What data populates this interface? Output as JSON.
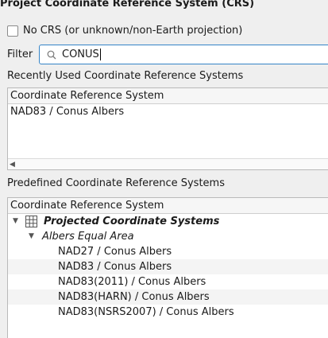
{
  "dialog": {
    "title": "Project Coordinate Reference System (CRS)"
  },
  "no_crs": {
    "label": "No CRS (or unknown/non-Earth projection)",
    "checked": false
  },
  "filter": {
    "label": "Filter",
    "value": "CONUS",
    "icon": "search-icon"
  },
  "recent": {
    "label": "Recently Used Coordinate Reference Systems",
    "column_header": "Coordinate Reference System",
    "items": [
      "NAD83 / Conus Albers"
    ]
  },
  "predefined": {
    "label": "Predefined Coordinate Reference Systems",
    "column_header": "Coordinate Reference System",
    "category": "Projected Coordinate Systems",
    "subcategory": "Albers Equal Area",
    "items": [
      "NAD27 / Conus Albers",
      "NAD83 / Conus Albers",
      "NAD83(2011) / Conus Albers",
      "NAD83(HARN) / Conus Albers",
      "NAD83(NSRS2007) / Conus Albers"
    ]
  },
  "colors": {
    "accent": "#3584c7",
    "background": "#efefef"
  }
}
